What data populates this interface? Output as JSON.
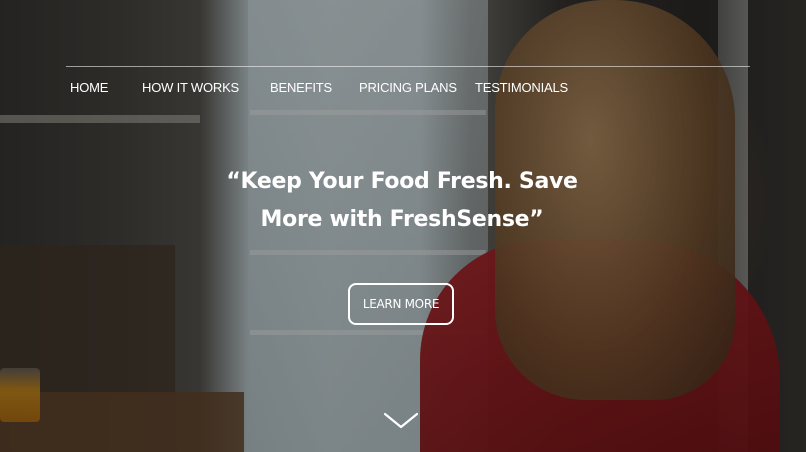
{
  "nav": {
    "items": [
      {
        "label": "HOME"
      },
      {
        "label": "HOW IT WORKS"
      },
      {
        "label": "BENEFITS"
      },
      {
        "label": "PRICING PLANS"
      },
      {
        "label": "TESTIMONIALS"
      }
    ]
  },
  "hero": {
    "headline_line1": "“Keep Your Food Fresh. Save",
    "headline_line2": "More with FreshSense”",
    "cta_label": "LEARN MORE",
    "scroll_icon": "chevron-down-icon"
  },
  "colors": {
    "text": "#ffffff",
    "nav_divider": "#ffffff"
  }
}
